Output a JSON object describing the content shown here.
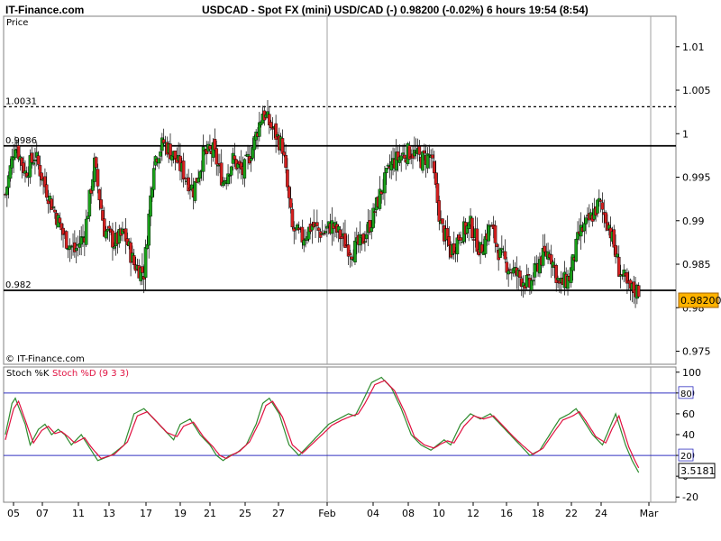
{
  "header": {
    "site": "IT-Finance.com",
    "title": "USDCAD - Spot FX (mini) USD/CAD (-)    0.98200 (-0.02%)    6 hours  19:54 (8:54)"
  },
  "price_panel": {
    "label": "Price",
    "watermark": "© IT-Finance.com",
    "current_price_label": "0.98200"
  },
  "stoch_panel": {
    "label_k": "Stoch %K",
    "label_d": "Stoch %D (9 3 3)",
    "current_value_label": "3.5181"
  },
  "colors": {
    "up_candle": "#1aa01a",
    "down_candle": "#d42020",
    "stoch_k": "#2e8b2e",
    "stoch_d": "#e01040",
    "level_line": "#000000",
    "stoch_band": "#3030c0",
    "price_box": "#ffb300"
  },
  "chart_data": [
    {
      "type": "candlestick",
      "title": "USDCAD - Spot FX (mini) USD/CAD (-)",
      "ylabel": "Price",
      "ylim": [
        0.9735,
        1.0135
      ],
      "y_ticks": [
        "1.01",
        "1.005",
        "1",
        "0.995",
        "0.99",
        "0.985",
        "0.98",
        "0.975"
      ],
      "x_ticks": [
        "05",
        "07",
        "11",
        "13",
        "17",
        "19",
        "21",
        "25",
        "27",
        "Feb",
        "04",
        "08",
        "10",
        "12",
        "16",
        "18",
        "22",
        "24",
        "Mar"
      ],
      "horizontal_levels": [
        {
          "value": 1.0031,
          "label": "1.0031",
          "style": "dashed"
        },
        {
          "value": 0.9986,
          "label": "0.9986",
          "style": "solid"
        },
        {
          "value": 0.982,
          "label": "0.982",
          "style": "solid"
        }
      ],
      "last_price": 0.982,
      "close_anchors": [
        [
          0,
          0.993
        ],
        [
          6,
          0.999
        ],
        [
          12,
          0.9955
        ],
        [
          18,
          0.9975
        ],
        [
          24,
          0.994
        ],
        [
          30,
          0.991
        ],
        [
          36,
          0.988
        ],
        [
          42,
          0.9865
        ],
        [
          48,
          0.9885
        ],
        [
          54,
          0.9965
        ],
        [
          60,
          0.989
        ],
        [
          66,
          0.9875
        ],
        [
          72,
          0.9885
        ],
        [
          78,
          0.985
        ],
        [
          84,
          0.984
        ],
        [
          90,
          0.997
        ],
        [
          96,
          0.999
        ],
        [
          102,
          0.9975
        ],
        [
          108,
          0.9955
        ],
        [
          114,
          0.9935
        ],
        [
          120,
          0.9975
        ],
        [
          126,
          0.998
        ],
        [
          132,
          0.9945
        ],
        [
          138,
          0.997
        ],
        [
          144,
          0.9955
        ],
        [
          150,
          0.9985
        ],
        [
          156,
          1.0025
        ],
        [
          162,
          1.0005
        ],
        [
          168,
          0.9985
        ],
        [
          174,
          0.989
        ],
        [
          180,
          0.988
        ],
        [
          186,
          0.9895
        ],
        [
          192,
          0.9885
        ],
        [
          198,
          0.9895
        ],
        [
          204,
          0.988
        ],
        [
          210,
          0.9865
        ],
        [
          216,
          0.9875
        ],
        [
          222,
          0.99
        ],
        [
          228,
          0.9935
        ],
        [
          234,
          0.9965
        ],
        [
          240,
          0.9975
        ],
        [
          246,
          0.998
        ],
        [
          252,
          0.997
        ],
        [
          258,
          0.9975
        ],
        [
          264,
          0.9895
        ],
        [
          270,
          0.9865
        ],
        [
          276,
          0.9885
        ],
        [
          282,
          0.9895
        ],
        [
          288,
          0.9865
        ],
        [
          294,
          0.9895
        ],
        [
          300,
          0.986
        ],
        [
          306,
          0.9845
        ],
        [
          312,
          0.9835
        ],
        [
          318,
          0.9825
        ],
        [
          324,
          0.9855
        ],
        [
          330,
          0.9865
        ],
        [
          336,
          0.9825
        ],
        [
          342,
          0.9835
        ],
        [
          348,
          0.9885
        ],
        [
          354,
          0.99
        ],
        [
          360,
          0.992
        ],
        [
          366,
          0.9895
        ],
        [
          372,
          0.9845
        ],
        [
          378,
          0.982
        ],
        [
          384,
          0.982
        ]
      ],
      "n_bars": 385
    },
    {
      "type": "line",
      "title": "Stoch %K / Stoch %D (9 3 3)",
      "ylim": [
        -25,
        105
      ],
      "y_ticks": [
        "100",
        "80",
        "60",
        "40",
        "20",
        "0",
        "-20"
      ],
      "bands": [
        80,
        20
      ],
      "series": [
        {
          "name": "Stoch %K",
          "anchors": [
            [
              0,
              40
            ],
            [
              4,
              70
            ],
            [
              6,
              75
            ],
            [
              12,
              50
            ],
            [
              15,
              30
            ],
            [
              20,
              45
            ],
            [
              24,
              50
            ],
            [
              28,
              40
            ],
            [
              32,
              45
            ],
            [
              36,
              40
            ],
            [
              40,
              30
            ],
            [
              46,
              40
            ],
            [
              50,
              30
            ],
            [
              56,
              15
            ],
            [
              64,
              20
            ],
            [
              72,
              30
            ],
            [
              78,
              60
            ],
            [
              84,
              65
            ],
            [
              90,
              55
            ],
            [
              96,
              45
            ],
            [
              102,
              35
            ],
            [
              106,
              50
            ],
            [
              112,
              55
            ],
            [
              118,
              40
            ],
            [
              124,
              30
            ],
            [
              128,
              20
            ],
            [
              132,
              15
            ],
            [
              136,
              20
            ],
            [
              140,
              22
            ],
            [
              146,
              30
            ],
            [
              152,
              50
            ],
            [
              156,
              70
            ],
            [
              160,
              75
            ],
            [
              166,
              60
            ],
            [
              172,
              30
            ],
            [
              178,
              20
            ],
            [
              184,
              30
            ],
            [
              190,
              40
            ],
            [
              196,
              50
            ],
            [
              202,
              55
            ],
            [
              208,
              60
            ],
            [
              212,
              58
            ],
            [
              216,
              70
            ],
            [
              222,
              90
            ],
            [
              228,
              95
            ],
            [
              234,
              85
            ],
            [
              240,
              65
            ],
            [
              246,
              40
            ],
            [
              252,
              30
            ],
            [
              258,
              25
            ],
            [
              262,
              30
            ],
            [
              266,
              35
            ],
            [
              270,
              30
            ],
            [
              276,
              50
            ],
            [
              282,
              60
            ],
            [
              288,
              55
            ],
            [
              294,
              60
            ],
            [
              300,
              50
            ],
            [
              306,
              40
            ],
            [
              312,
              30
            ],
            [
              318,
              20
            ],
            [
              324,
              25
            ],
            [
              330,
              40
            ],
            [
              336,
              55
            ],
            [
              342,
              60
            ],
            [
              346,
              65
            ],
            [
              350,
              55
            ],
            [
              356,
              40
            ],
            [
              362,
              30
            ],
            [
              366,
              45
            ],
            [
              370,
              60
            ],
            [
              376,
              30
            ],
            [
              380,
              15
            ],
            [
              384,
              3.5
            ]
          ]
        },
        {
          "name": "Stoch %D (9 3 3)",
          "anchors": [
            [
              0,
              35
            ],
            [
              5,
              65
            ],
            [
              8,
              72
            ],
            [
              14,
              45
            ],
            [
              17,
              32
            ],
            [
              22,
              44
            ],
            [
              26,
              48
            ],
            [
              30,
              41
            ],
            [
              34,
              43
            ],
            [
              38,
              38
            ],
            [
              42,
              32
            ],
            [
              48,
              37
            ],
            [
              52,
              28
            ],
            [
              58,
              17
            ],
            [
              66,
              21
            ],
            [
              74,
              33
            ],
            [
              80,
              58
            ],
            [
              86,
              62
            ],
            [
              92,
              52
            ],
            [
              98,
              42
            ],
            [
              104,
              38
            ],
            [
              108,
              48
            ],
            [
              114,
              52
            ],
            [
              120,
              38
            ],
            [
              126,
              28
            ],
            [
              130,
              20
            ],
            [
              134,
              17
            ],
            [
              138,
              21
            ],
            [
              142,
              24
            ],
            [
              148,
              33
            ],
            [
              154,
              52
            ],
            [
              158,
              68
            ],
            [
              162,
              72
            ],
            [
              168,
              57
            ],
            [
              174,
              30
            ],
            [
              180,
              22
            ],
            [
              186,
              31
            ],
            [
              192,
              40
            ],
            [
              198,
              49
            ],
            [
              204,
              54
            ],
            [
              210,
              58
            ],
            [
              214,
              60
            ],
            [
              218,
              70
            ],
            [
              224,
              88
            ],
            [
              230,
              92
            ],
            [
              236,
              82
            ],
            [
              242,
              62
            ],
            [
              248,
              38
            ],
            [
              254,
              30
            ],
            [
              260,
              27
            ],
            [
              264,
              31
            ],
            [
              268,
              34
            ],
            [
              272,
              32
            ],
            [
              278,
              48
            ],
            [
              284,
              58
            ],
            [
              290,
              55
            ],
            [
              296,
              58
            ],
            [
              302,
              48
            ],
            [
              308,
              38
            ],
            [
              314,
              29
            ],
            [
              320,
              21
            ],
            [
              326,
              27
            ],
            [
              332,
              41
            ],
            [
              338,
              54
            ],
            [
              344,
              58
            ],
            [
              348,
              62
            ],
            [
              352,
              53
            ],
            [
              358,
              38
            ],
            [
              364,
              32
            ],
            [
              368,
              46
            ],
            [
              372,
              58
            ],
            [
              378,
              28
            ],
            [
              382,
              14
            ],
            [
              384,
              8
            ]
          ]
        }
      ]
    }
  ]
}
